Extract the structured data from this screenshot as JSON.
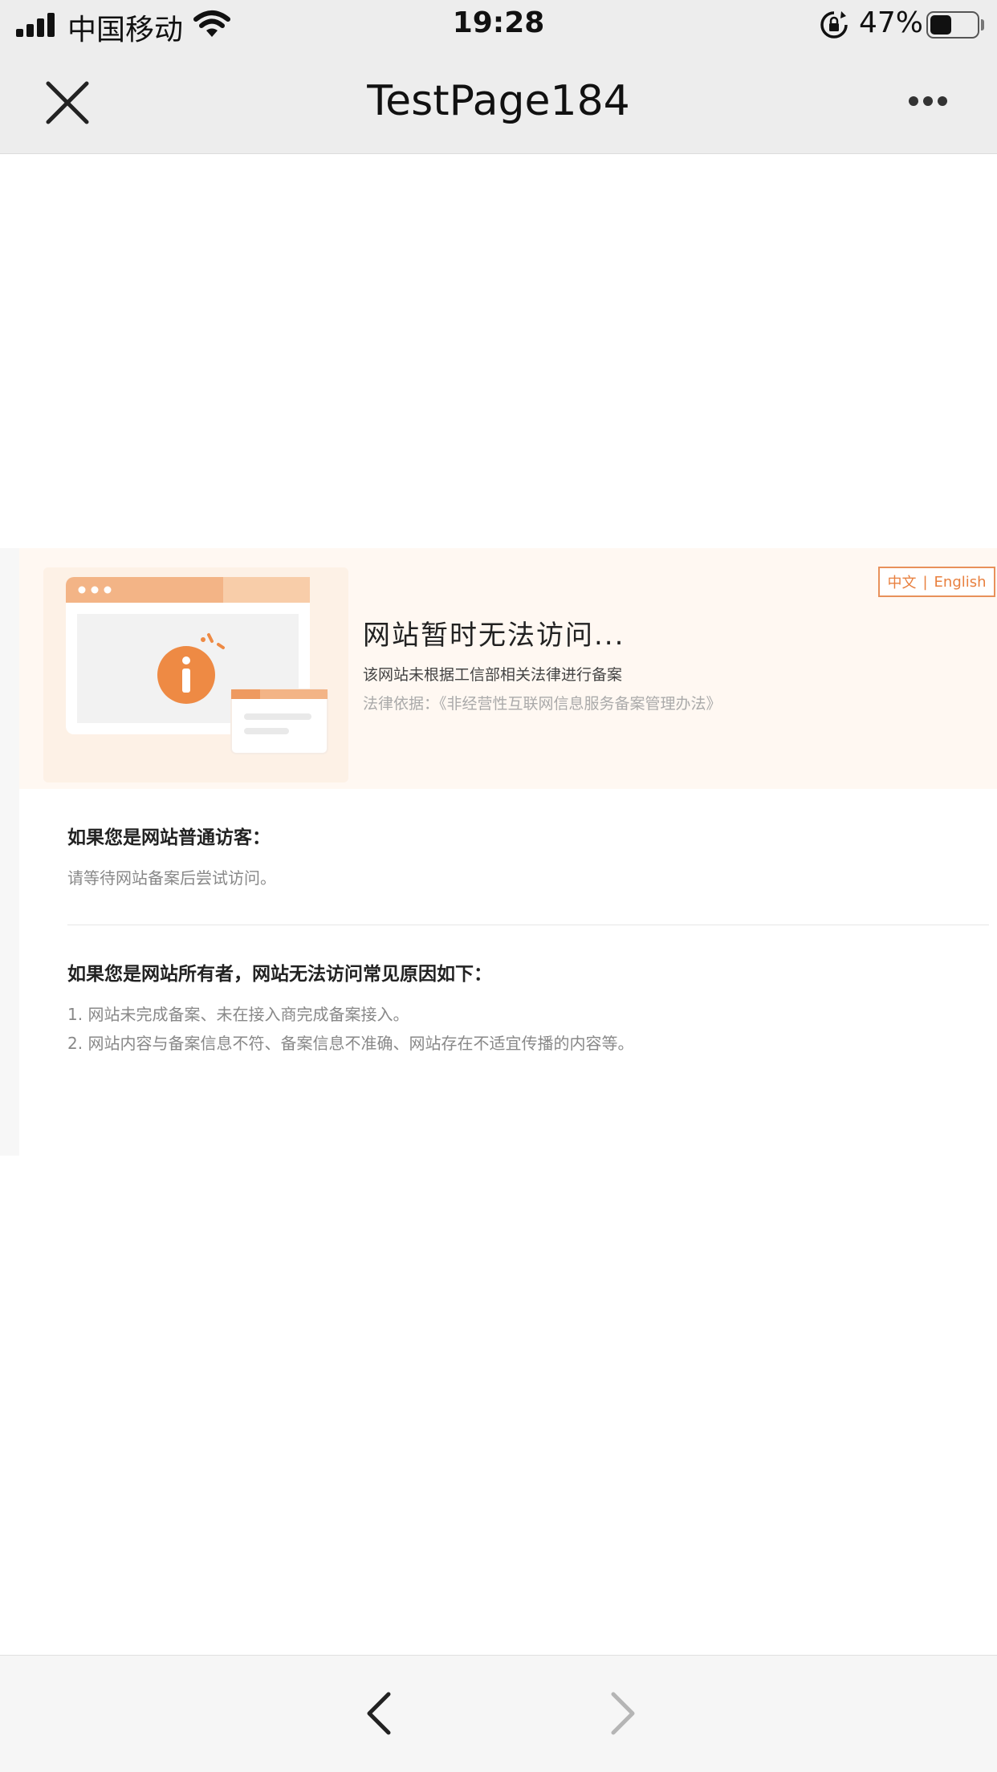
{
  "status_bar": {
    "carrier": "中国移动",
    "time": "19:28",
    "battery_percent": "47%",
    "battery_level": 0.47
  },
  "nav": {
    "title": "TestPage184",
    "close_icon": "close-icon",
    "more_icon": "more-icon"
  },
  "banner": {
    "lang_zh": "中文",
    "lang_sep": "|",
    "lang_en": "English",
    "title": "网站暂时无法访问...",
    "subtitle": "该网站未根据工信部相关法律进行备案",
    "law": "法律依据：《非经营性互联网信息服务备案管理办法》"
  },
  "visitor": {
    "title": "如果您是网站普通访客：",
    "text": "请等待网站备案后尝试访问。"
  },
  "owner": {
    "title": "如果您是网站所有者，网站无法访问常见原因如下：",
    "reasons": [
      "1. 网站未完成备案、未在接入商完成备案接入。",
      "2. 网站内容与备案信息不符、备案信息不准确、网站存在不适宜传播的内容等。"
    ]
  },
  "toolbar": {
    "back_icon": "chevron-left-icon",
    "forward_icon": "chevron-right-icon"
  },
  "colors": {
    "accent": "#e8803f",
    "banner_bg": "#fff8f2",
    "bar_bg": "#ededed"
  }
}
